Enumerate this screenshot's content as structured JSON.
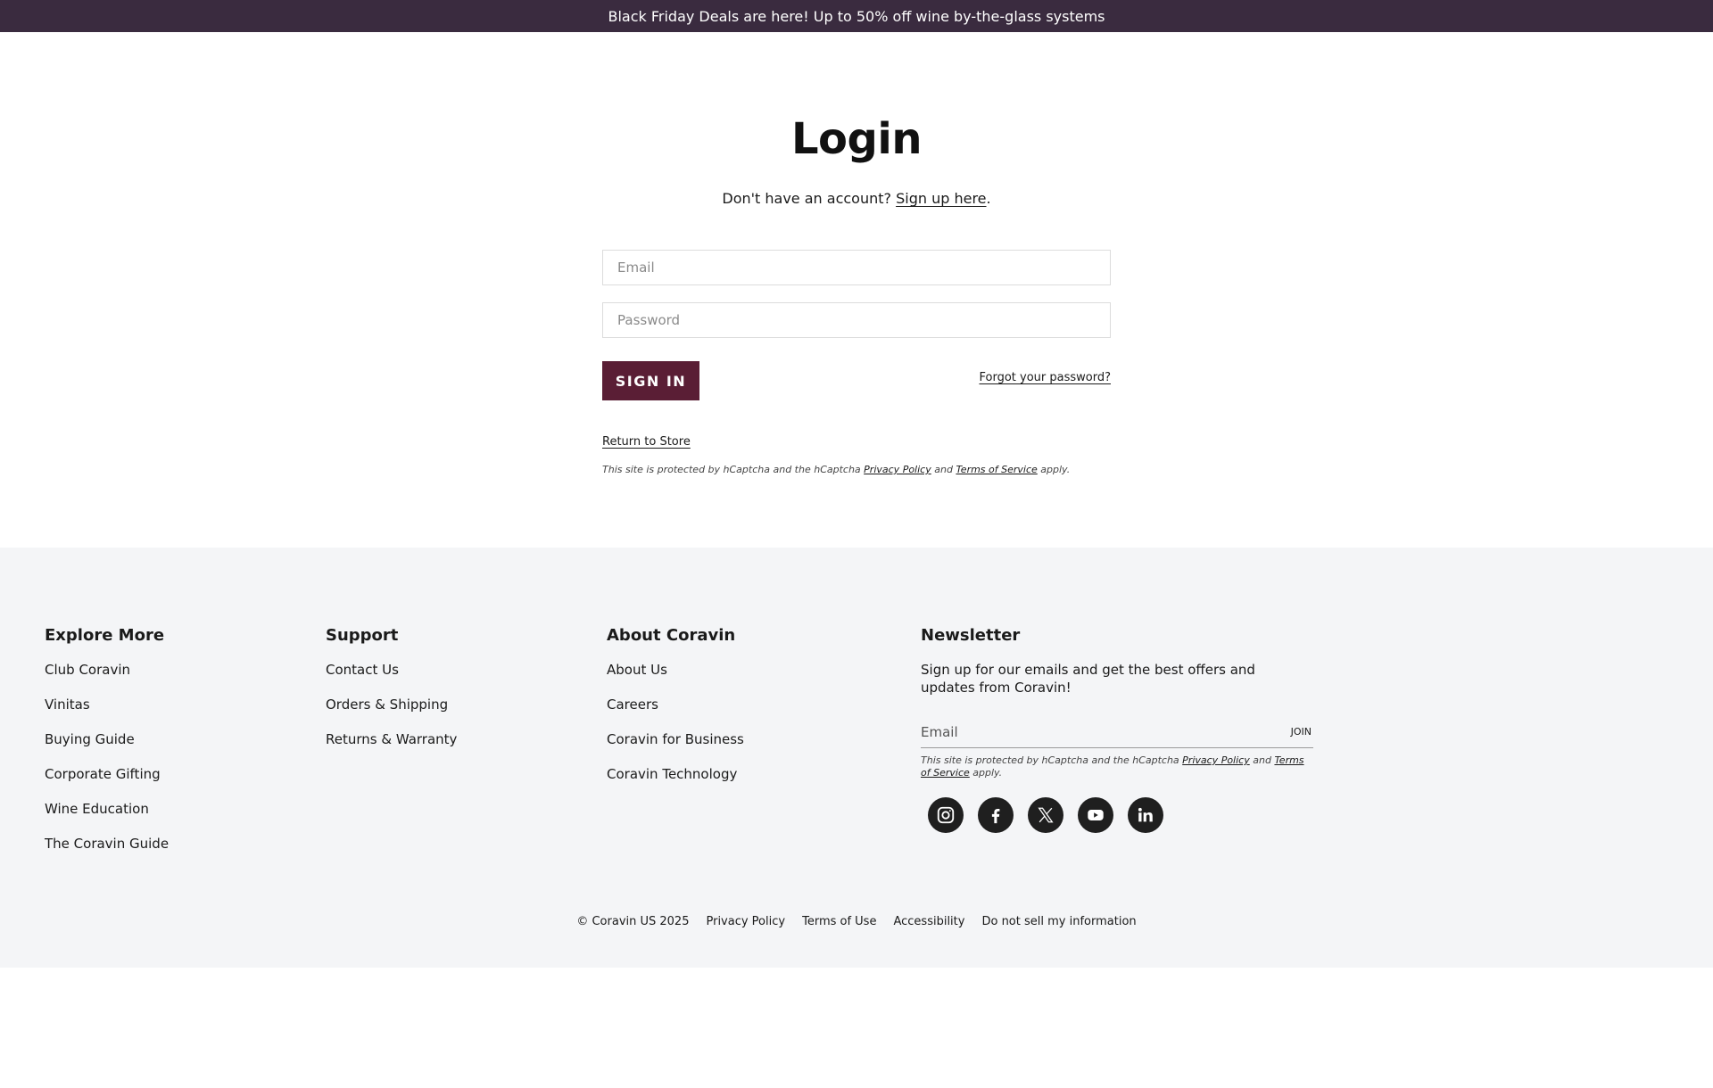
{
  "announcement": "Black Friday Deals are here! Up to 50% off wine by-the-glass systems",
  "login": {
    "title": "Login",
    "no_account": "Don't have an account?",
    "signup_link": "Sign up here",
    "signup_period": ".",
    "email_placeholder": "Email",
    "email_value": "",
    "password_placeholder": "Password",
    "password_value": "",
    "signin_label": "SIGN IN",
    "forgot_label": "Forgot your password?",
    "return_label": "Return to Store",
    "captcha": {
      "prefix": "This site is protected by hCaptcha and the hCaptcha",
      "privacy": "Privacy Policy",
      "and": "and",
      "terms": "Terms of Service",
      "suffix": "apply."
    }
  },
  "footer": {
    "explore": {
      "heading": "Explore More",
      "items": [
        "Club Coravin",
        "Vinitas",
        "Buying Guide",
        "Corporate Gifting",
        "Wine Education",
        "The Coravin Guide"
      ]
    },
    "support": {
      "heading": "Support",
      "items": [
        "Contact Us",
        "Orders & Shipping",
        "Returns & Warranty"
      ]
    },
    "about": {
      "heading": "About Coravin",
      "items": [
        "About Us",
        "Careers",
        "Coravin for Business",
        "Coravin Technology"
      ]
    },
    "newsletter": {
      "heading": "Newsletter",
      "text": "Sign up for our emails and get the best offers and updates from Coravin!",
      "email_placeholder": "Email",
      "email_value": "",
      "join_label": "JOIN",
      "captcha": {
        "prefix": "This site is protected by hCaptcha and the hCaptcha",
        "privacy": "Privacy Policy",
        "and": "and",
        "terms": "Terms of Service",
        "suffix": "apply."
      }
    },
    "socials": [
      "instagram-icon",
      "facebook-icon",
      "x-icon",
      "youtube-icon",
      "linkedin-icon"
    ],
    "legal": {
      "copyright": "© Coravin US 2025",
      "privacy": "Privacy Policy",
      "terms": "Terms of Use",
      "accessibility": "Accessibility",
      "do_not_sell": "Do not sell my information"
    }
  },
  "colors": {
    "announcement_bg": "#3a2b3f",
    "signin_bg": "#5a1e35",
    "footer_bg": "#f4f5f7"
  }
}
